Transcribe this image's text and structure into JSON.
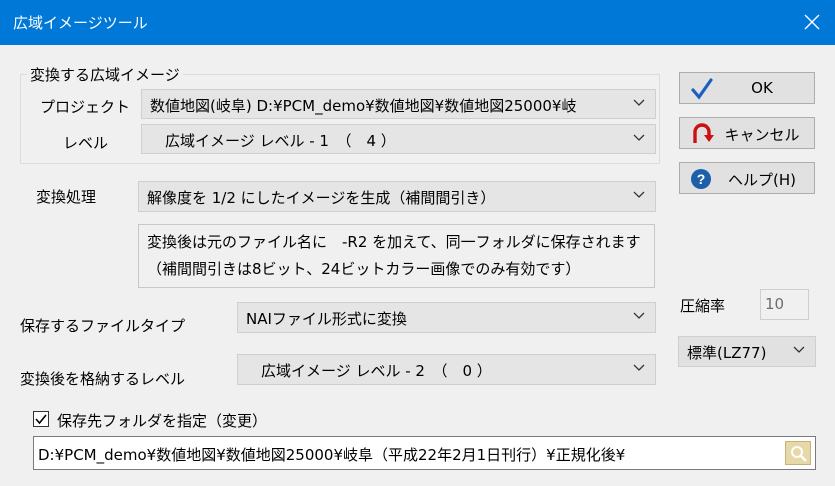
{
  "window": {
    "title": "広域イメージツール"
  },
  "group": {
    "title": "変換する広域イメージ",
    "project_label": "プロジェクト",
    "project_value": "数値地図(岐阜) D:¥PCM_demo¥数値地図¥数値地図25000¥岐",
    "level_label": "レベル",
    "level_value": "　広域イメージ レベル - 1　（　4 ）"
  },
  "process": {
    "label": "変換処理",
    "value": "解像度を 1/2 にしたイメージを生成（補間間引き）",
    "info_line1": "変換後は元のファイル名に　-R2 を加えて、同一フォルダに保存されます",
    "info_line2": "（補間間引きは8ビット、24ビットカラー画像でのみ有効です）"
  },
  "filetype": {
    "label": "保存するファイルタイプ",
    "value": "NAIファイル形式に変換"
  },
  "dest_level": {
    "label": "変換後を格納するレベル",
    "value": "　広域イメージ レベル - 2　（　0 ）"
  },
  "compression": {
    "label": "圧縮率",
    "rate": "10",
    "mode": "標準(LZ77)"
  },
  "buttons": {
    "ok": "OK",
    "cancel": "キャンセル",
    "help": "ヘルプ(H)"
  },
  "save_folder": {
    "checkbox_label": "保存先フォルダを指定（変更）",
    "checked": true,
    "path": "D:¥PCM_demo¥数値地図¥数値地図25000¥岐阜（平成22年2月1日刊行）¥正規化後¥"
  },
  "icons": {
    "close": "close-icon",
    "ok": "checkmark-icon",
    "cancel": "undo-arrow-icon",
    "help": "help-icon",
    "dropdown": "chevron-down-icon",
    "browse": "folder-search-icon"
  },
  "colors": {
    "titlebar": "#0078d7",
    "help_icon": "#1d5fa8",
    "cancel_icon": "#cc1111",
    "ok_icon": "#1b5fc2"
  }
}
